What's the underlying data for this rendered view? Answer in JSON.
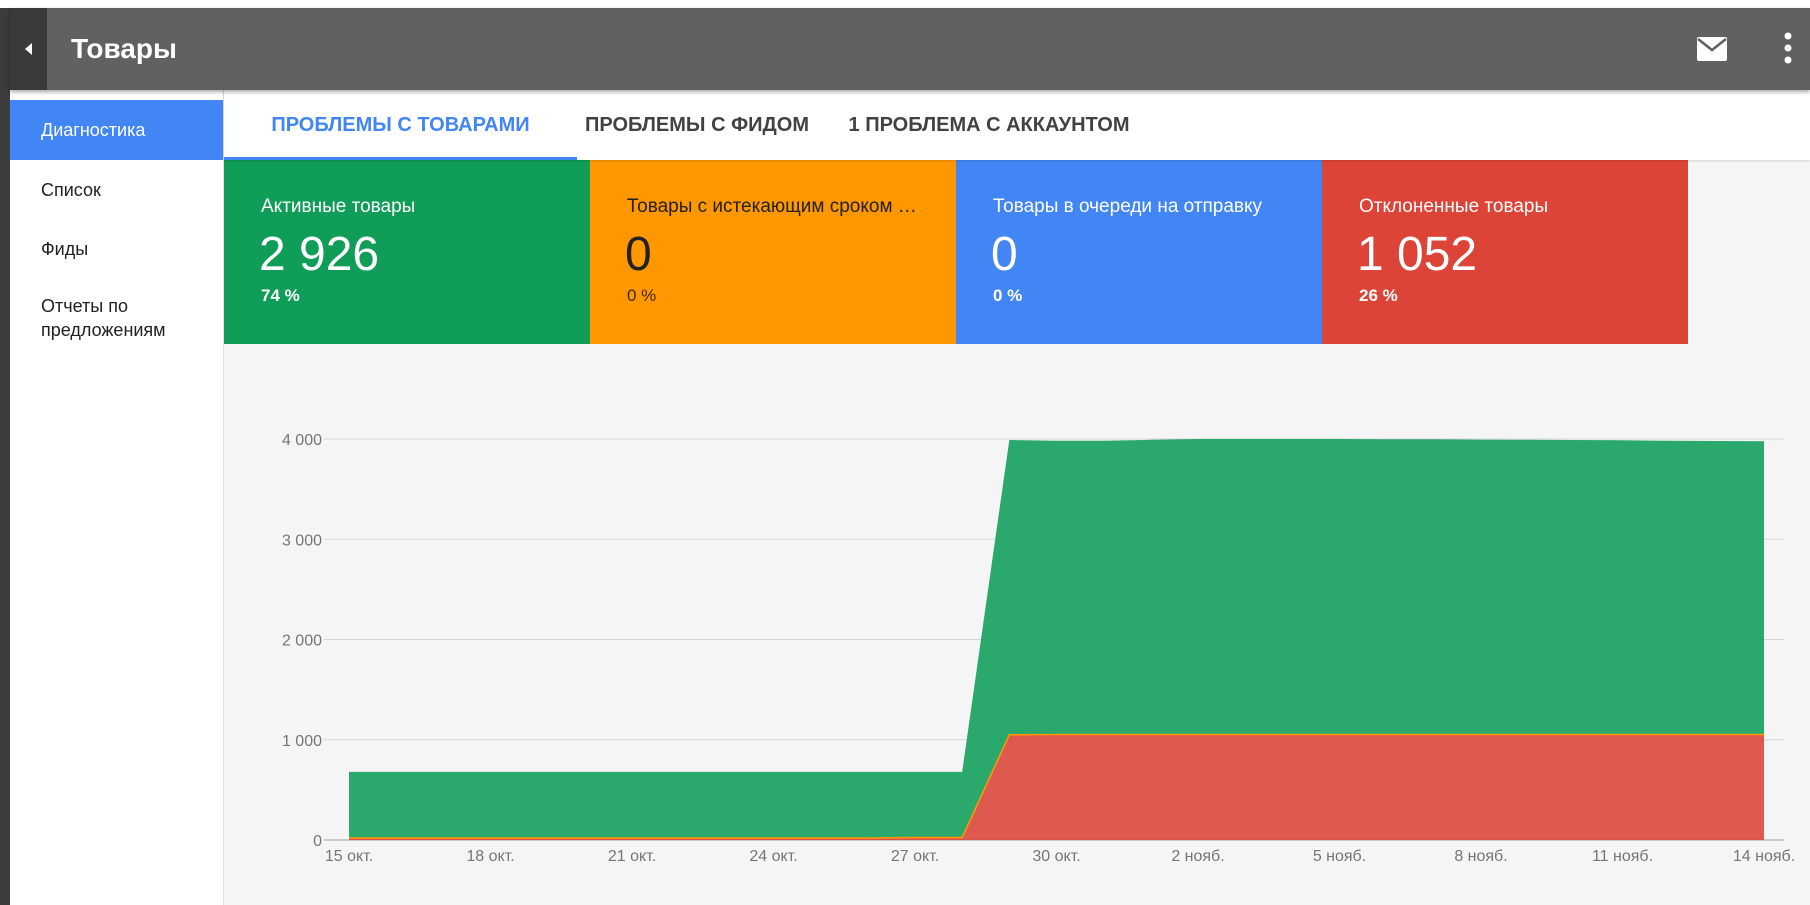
{
  "app": {
    "title": "Товары"
  },
  "sidebar": {
    "items": [
      {
        "label": "Диагностика",
        "active": true
      },
      {
        "label": "Список"
      },
      {
        "label": "Фиды"
      },
      {
        "label": "Отчеты по предложениям",
        "line1": "Отчеты по",
        "line2": "предложениям"
      }
    ]
  },
  "tabs": [
    {
      "label": "Проблемы с товарами",
      "active": true
    },
    {
      "label": "Проблемы с фидом"
    },
    {
      "label": "1 проблема с аккаунтом"
    }
  ],
  "cards": [
    {
      "title": "Активные товары",
      "value": "2 926",
      "percent": "74 %",
      "color": "#0f9d58"
    },
    {
      "title": "Товары с истекающим сроком …",
      "value": "0",
      "percent": "0 %",
      "color": "#ff9800"
    },
    {
      "title": "Товары в очереди на отправку",
      "value": "0",
      "percent": "0 %",
      "color": "#4285f4"
    },
    {
      "title": "Отклоненные товары",
      "value": "1 052",
      "percent": "26 %",
      "color": "#db4437"
    }
  ],
  "icons": {
    "back": "back-arrow-icon",
    "mail": "mail-icon",
    "more": "more-vert-icon"
  },
  "chart_data": {
    "type": "area",
    "stacked": true,
    "x": [
      "15 окт.",
      "16 окт.",
      "17 окт.",
      "18 окт.",
      "19 окт.",
      "20 окт.",
      "21 окт.",
      "22 окт.",
      "23 окт.",
      "24 окт.",
      "25 окт.",
      "26 окт.",
      "27 окт.",
      "28 окт.",
      "29 окт.",
      "30 окт.",
      "31 окт.",
      "1 нояб.",
      "2 нояб.",
      "3 нояб.",
      "4 нояб.",
      "5 нояб.",
      "6 нояб.",
      "7 нояб.",
      "8 нояб.",
      "9 нояб.",
      "10 нояб.",
      "11 нояб.",
      "12 нояб.",
      "13 нояб.",
      "14 нояб."
    ],
    "x_ticks": [
      "15 окт.",
      "18 окт.",
      "21 окт.",
      "24 окт.",
      "27 окт.",
      "30 окт.",
      "2 нояб.",
      "5 нояб.",
      "8 нояб.",
      "11 нояб.",
      "14 нояб."
    ],
    "series": [
      {
        "color": "#db4437",
        "values": [
          20,
          20,
          20,
          20,
          20,
          20,
          20,
          20,
          20,
          20,
          20,
          20,
          25,
          25,
          1050,
          1052,
          1052,
          1052,
          1052,
          1052,
          1052,
          1052,
          1052,
          1052,
          1052,
          1052,
          1052,
          1052,
          1052,
          1052,
          1052
        ]
      },
      {
        "color": "#0f9d58",
        "values": [
          660,
          660,
          660,
          660,
          660,
          660,
          660,
          660,
          660,
          660,
          660,
          660,
          655,
          655,
          2940,
          2930,
          2930,
          2940,
          2948,
          2948,
          2948,
          2948,
          2945,
          2945,
          2942,
          2940,
          2938,
          2935,
          2930,
          2928,
          2926
        ]
      }
    ],
    "ylim": [
      0,
      4000
    ],
    "y_ticks": [
      "4 000",
      "3 000",
      "2 000",
      "1 000",
      "0"
    ],
    "y_tick_values": [
      4000,
      3000,
      2000,
      1000,
      0
    ],
    "grid": true
  }
}
